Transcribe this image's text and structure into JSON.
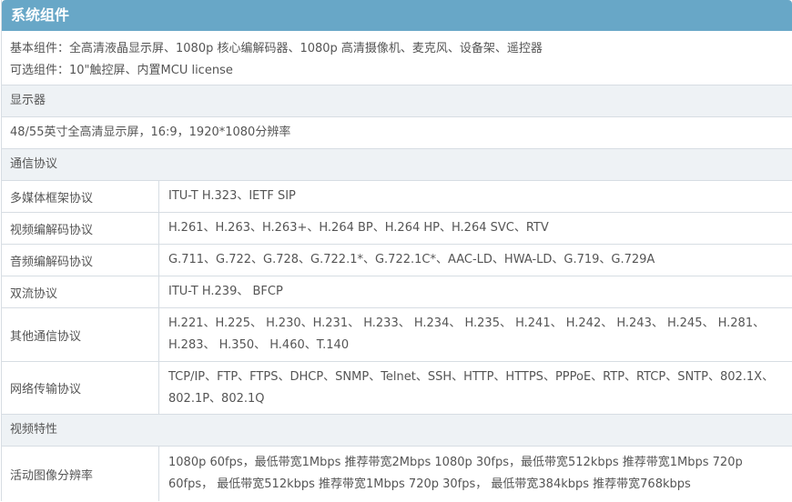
{
  "title": "系统组件",
  "components": {
    "basic": "基本组件：全高清液晶显示屏、1080p 核心编解码器、1080p 高清摄像机、麦克风、设备架、遥控器",
    "optional": "可选组件：10\"触控屏、内置MCU license"
  },
  "display": {
    "header": "显示器",
    "value": "48/55英寸全高清显示屏，16:9，1920*1080分辨率"
  },
  "protocols": {
    "header": "通信协议",
    "rows": [
      {
        "key": "多媒体框架协议",
        "value": "ITU-T H.323、IETF SIP"
      },
      {
        "key": "视频编解码协议",
        "value": "H.261、H.263、H.263+、H.264 BP、H.264 HP、H.264 SVC、RTV"
      },
      {
        "key": "音频编解码协议",
        "value": "G.711、G.722、G.728、G.722.1*、G.722.1C*、AAC-LD、HWA-LD、G.719、G.729A"
      },
      {
        "key": "双流协议",
        "value": "ITU-T H.239、 BFCP"
      },
      {
        "key": "其他通信协议",
        "value": "H.221、H.225、 H.230、H.231、 H.233、 H.234、 H.235、 H.241、 H.242、 H.243、 H.245、 H.281、 H.283、 H.350、 H.460、T.140"
      },
      {
        "key": "网络传输协议",
        "value": "TCP/IP、FTP、FTPS、DHCP、SNMP、Telnet、SSH、HTTP、HTTPS、PPPoE、RTP、RTCP、SNTP、802.1X、802.1P、802.1Q"
      }
    ]
  },
  "video": {
    "header": "视频特性",
    "rows": [
      {
        "key": "活动图像分辨率",
        "value": "1080p 60fps，最低带宽1Mbps 推荐带宽2Mbps 1080p 30fps，最低带宽512kbps 推荐带宽1Mbps 720p 60fps， 最低带宽512kbps 推荐带宽1Mbps 720p 30fps， 最低带宽384kbps 推荐带宽768kbps"
      }
    ]
  }
}
